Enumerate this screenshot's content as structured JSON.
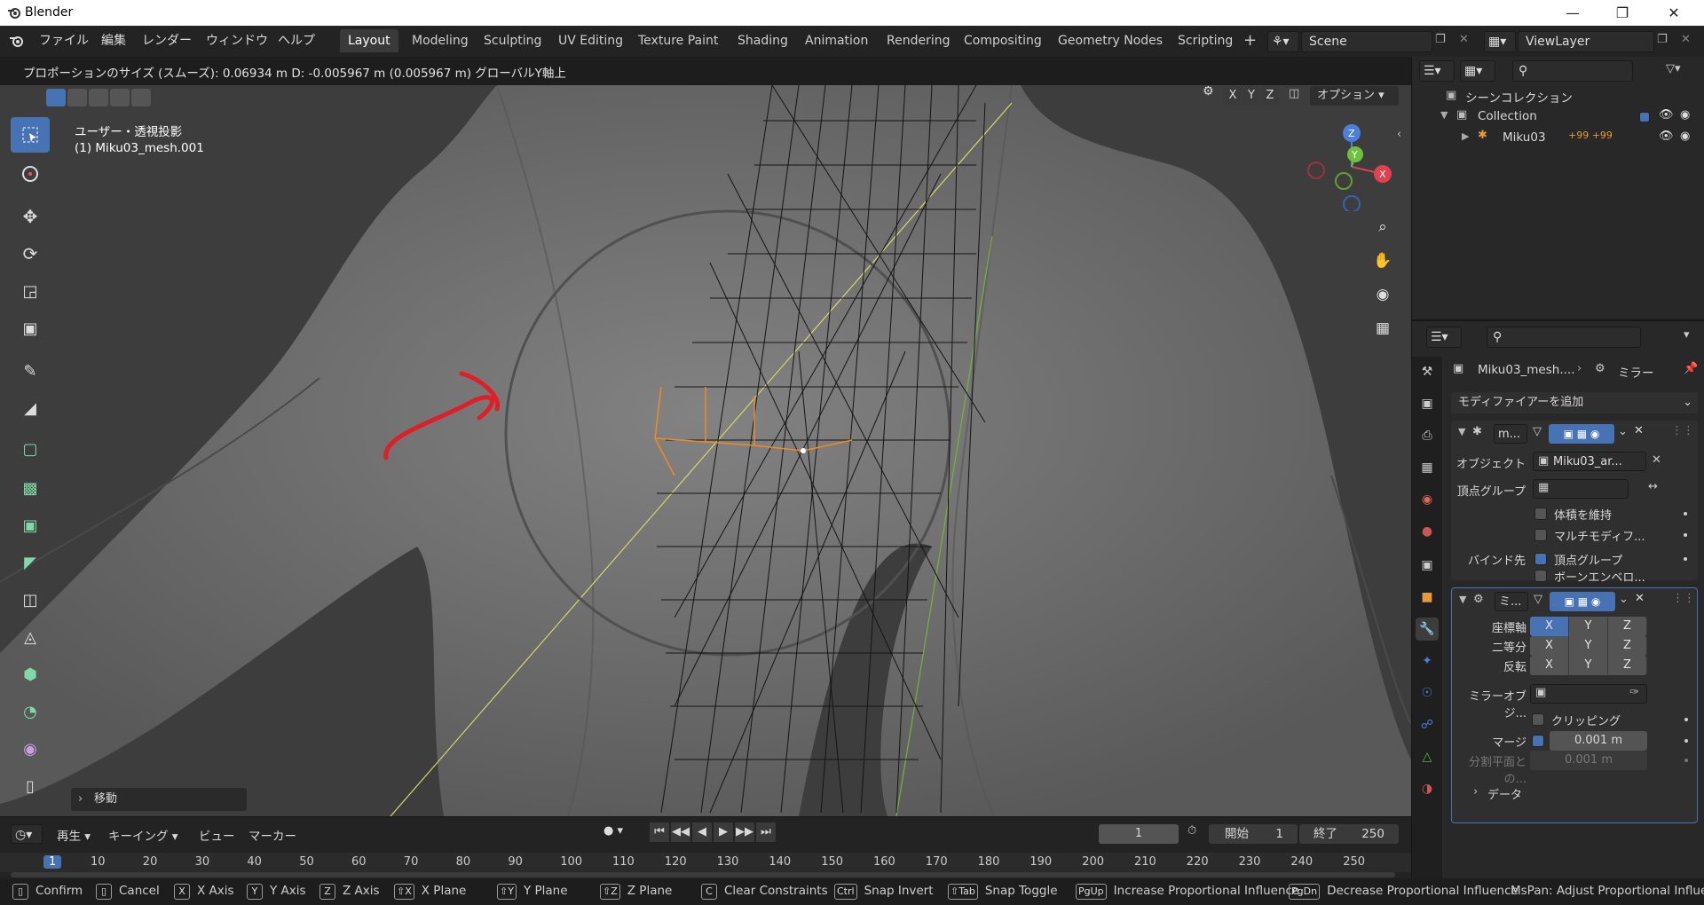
{
  "window": {
    "title": "Blender"
  },
  "menu": [
    "ファイル",
    "編集",
    "レンダー",
    "ウィンドウ",
    "ヘルプ"
  ],
  "workspaces": [
    "Layout",
    "Modeling",
    "Sculpting",
    "UV Editing",
    "Texture Paint",
    "Shading",
    "Animation",
    "Rendering",
    "Compositing",
    "Geometry Nodes",
    "Scripting"
  ],
  "active_workspace": "Layout",
  "scene": {
    "label": "Scene",
    "view_layer": "ViewLayer"
  },
  "operator_status": "プロポーションのサイズ (スムーズ): 0.06934 m   D: -0.005967 m (0.005967 m) グローバルY軸上",
  "viewport": {
    "view_name": "ユーザー・透視投影",
    "object_name": "(1) Miku03_mesh.001",
    "axes": [
      "X",
      "Y",
      "Z"
    ],
    "options_label": "オプション",
    "last_op_label": "移動",
    "gizmo": {
      "x": "X",
      "y": "Y",
      "z": "Z"
    }
  },
  "outliner": {
    "root": "シーンコレクション",
    "collection": "Collection",
    "object": "Miku03",
    "badge": "+99 +99"
  },
  "properties": {
    "breadcrumb_object": "Miku03_mesh....",
    "breadcrumb_modifier": "ミラー",
    "add_modifier": "モディファイアーを追加",
    "armature_mod": {
      "name": "m...",
      "object_label": "オブジェクト",
      "object_value": "Miku03_ar...",
      "vgroup_label": "頂点グループ",
      "preserve_volume": "体積を維持",
      "multi_modifier": "マルチモディフ...",
      "bind_label": "バインド先",
      "bind_vgroups": "頂点グループ",
      "bind_bone_env": "ボーンエンベロ..."
    },
    "mirror_mod": {
      "name": "ミ...",
      "axis_label": "座標軸",
      "bisect_label": "二等分",
      "flip_label": "反転",
      "mirror_obj_label": "ミラーオブジ...",
      "clipping": "クリッピング",
      "merge_label": "マージ",
      "merge_value": "0.001 m",
      "bisect_dist_label": "分割平面との...",
      "bisect_dist_value": "0.001 m",
      "data_label": "データ"
    }
  },
  "timeline": {
    "menus": [
      "再生",
      "キーイング",
      "ビュー",
      "マーカー"
    ],
    "current_frame": "1",
    "start_label": "開始",
    "start": "1",
    "end_label": "終了",
    "end": "250",
    "ticks": [
      "1",
      "10",
      "20",
      "30",
      "40",
      "50",
      "60",
      "70",
      "80",
      "90",
      "100",
      "110",
      "120",
      "130",
      "140",
      "150",
      "160",
      "170",
      "180",
      "190",
      "200",
      "210",
      "220",
      "230",
      "240",
      "250"
    ]
  },
  "statusbar": [
    {
      "key": "",
      "label": "Confirm"
    },
    {
      "key": "",
      "label": "Cancel"
    },
    {
      "key": "X",
      "label": "X Axis"
    },
    {
      "key": "Y",
      "label": "Y Axis"
    },
    {
      "key": "Z",
      "label": "Z Axis"
    },
    {
      "key": "⇧X",
      "label": "X Plane"
    },
    {
      "key": "⇧Y",
      "label": "Y Plane"
    },
    {
      "key": "⇧Z",
      "label": "Z Plane"
    },
    {
      "key": "C",
      "label": "Clear Constraints"
    },
    {
      "key": "Ctrl",
      "label": "Snap Invert"
    },
    {
      "key": "⇧Tab",
      "label": "Snap Toggle"
    },
    {
      "key": "PgUp",
      "label": "Increase Proportional Influence"
    },
    {
      "key": "PgDn",
      "label": "Decrease Proportional Influence"
    },
    {
      "key": "",
      "label": "MsPan: Adjust Proportional Influence"
    }
  ],
  "colors": {
    "accent": "#4772b3",
    "selection": "#f08a24",
    "annotation": "#e01e2a"
  }
}
